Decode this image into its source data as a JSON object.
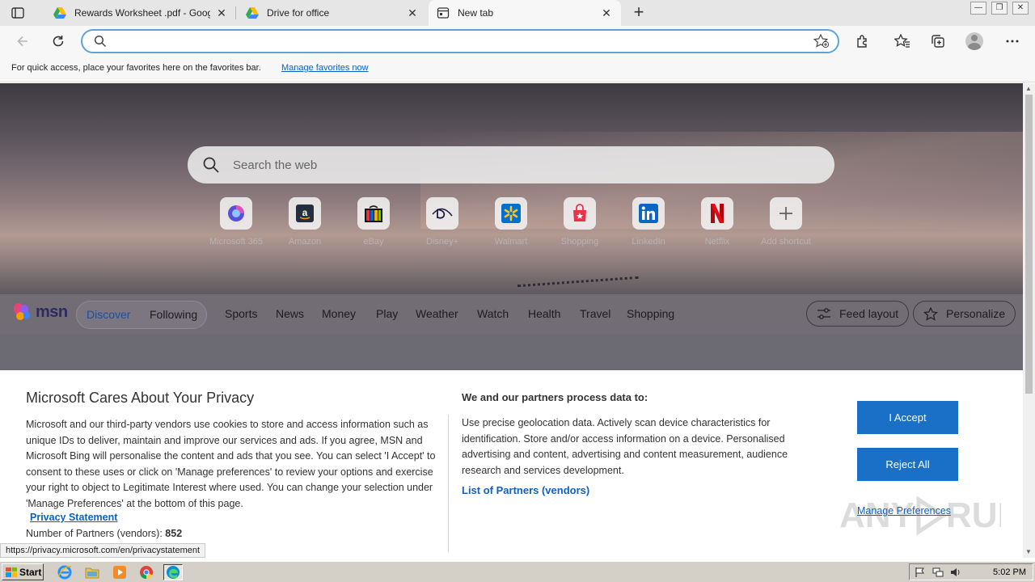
{
  "tabs": [
    {
      "title": "Rewards Worksheet .pdf - Goog",
      "icon": "google-drive-icon",
      "active": false
    },
    {
      "title": "Drive for office",
      "icon": "google-drive-icon",
      "active": false
    },
    {
      "title": "New tab",
      "icon": "new-tab-page-icon",
      "active": true
    }
  ],
  "window_controls": {
    "minimize": "—",
    "restore": "❐",
    "close": "✕"
  },
  "address_bar": {
    "value": "",
    "placeholder": ""
  },
  "favorites_bar": {
    "message": "For quick access, place your favorites here on the favorites bar.",
    "link": "Manage favorites now"
  },
  "search": {
    "placeholder": "Search the web"
  },
  "shortcuts": [
    {
      "label": "Microsoft 365",
      "icon": "microsoft-365-icon"
    },
    {
      "label": "Amazon",
      "icon": "amazon-icon"
    },
    {
      "label": "eBay",
      "icon": "ebay-icon"
    },
    {
      "label": "Disney+",
      "icon": "disney-plus-icon"
    },
    {
      "label": "Walmart",
      "icon": "walmart-icon"
    },
    {
      "label": "Shopping",
      "icon": "shopping-bag-icon"
    },
    {
      "label": "LinkedIn",
      "icon": "linkedin-icon"
    },
    {
      "label": "Netflix",
      "icon": "netflix-icon"
    },
    {
      "label": "Add shortcut",
      "icon": "plus-icon"
    }
  ],
  "msn": {
    "logo": "msn",
    "pills": [
      "Discover",
      "Following"
    ],
    "nav": [
      "Sports",
      "News",
      "Money",
      "Play",
      "Weather",
      "Watch",
      "Health",
      "Travel",
      "Shopping"
    ],
    "feed_layout": "Feed layout",
    "personalize": "Personalize"
  },
  "privacy": {
    "title": "Microsoft Cares About Your Privacy",
    "body": "Microsoft and our third-party vendors use cookies to store and access information such as unique IDs to deliver, maintain and improve our services and ads. If you agree, MSN and Microsoft Bing will personalise the content and ads that you see. You can select 'I Accept' to consent to these uses or click on 'Manage preferences' to review your options and exercise your right to object to Legitimate Interest where used.  You can change your selection under 'Manage Preferences' at the bottom of this page.",
    "statement_link": "Privacy Statement",
    "partners_label": "Number of Partners (vendors):",
    "partners_count": "852",
    "subtitle": "We and our partners process data to:",
    "purposes": "Use precise geolocation data. Actively scan device characteristics for identification. Store and/or access information on a device. Personalised advertising and content, advertising and content measurement, audience research and services development.",
    "vendors_link": "List of Partners (vendors)",
    "accept": "I Accept",
    "reject": "Reject All",
    "manage": "Manage Preferences"
  },
  "status_url": "https://privacy.microsoft.com/en/privacystatement",
  "taskbar": {
    "start": "Start",
    "clock": "5:02 PM"
  },
  "colors": {
    "accent": "#1a6fc7",
    "link": "#0b62c4",
    "address_focus": "#5ea3e0"
  }
}
